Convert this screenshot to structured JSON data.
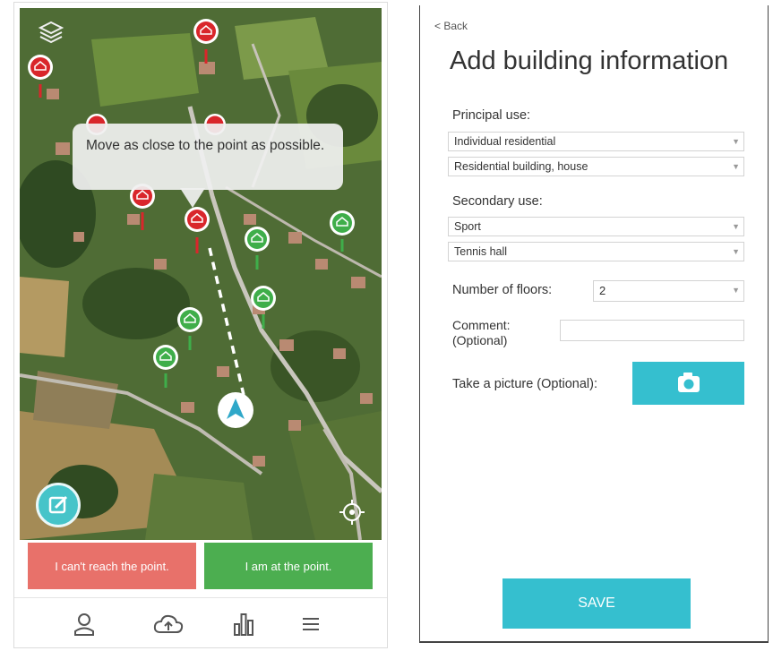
{
  "left_screen": {
    "tooltip": {
      "text": "Move as close to the point as possible."
    },
    "buttons": {
      "cant_reach": "I can't reach the point.",
      "at_point": "I am at the point."
    },
    "bottom_nav": {
      "items": [
        "profile-icon",
        "cloud-upload-icon",
        "stats-icon",
        "menu-icon"
      ]
    },
    "marker_colors": {
      "pending": "#d9262b",
      "done": "#3fae4a"
    }
  },
  "right_screen": {
    "back_label": "Back",
    "title": "Add building information",
    "principal_use": {
      "label": "Principal use:",
      "category": "Individual residential",
      "type": "Residential building, house"
    },
    "secondary_use": {
      "label": "Secondary use:",
      "category": "Sport",
      "type": "Tennis hall"
    },
    "floors": {
      "label": "Number of floors:",
      "value": "2"
    },
    "comment": {
      "label_line1": "Comment:",
      "label_line2": "(Optional)",
      "value": ""
    },
    "picture": {
      "label": "Take a picture (Optional):"
    },
    "save_label": "SAVE",
    "accent_color": "#35bfcf"
  }
}
